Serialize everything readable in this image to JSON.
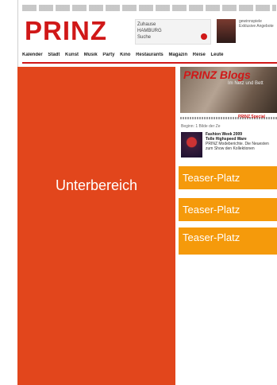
{
  "header": {
    "logo": "PRINZ",
    "city_box": {
      "line1": "Zuhause",
      "line2": "HAMBURG",
      "line3": "Suche"
    },
    "promo": {
      "line1": "gewinnspiele",
      "line2": "Exklusive Angebote"
    },
    "nav_items": [
      "Kalender",
      "Stadt",
      "Kunst",
      "Musik",
      "Party",
      "Kino",
      "Restaurants",
      "Magazin",
      "Reise",
      "Leute"
    ]
  },
  "main": {
    "unterbereich_label": "Unterbereich"
  },
  "sidebar": {
    "blogs_title": "PRINZ Blogs",
    "blogs_subtitle": "Im Netz und Bett",
    "special_label": "PRINZ Special",
    "meta_line": "Beginn: 1 Bilde der Ze",
    "article": {
      "headline": "Fashion Week 2009",
      "subline": "Tolle Highspeed Ware",
      "body": "PRINZ Modeberichte. Die Neuesten zum Show den Kollektionen"
    },
    "teasers": [
      "Teaser-Platz",
      "Teaser-Platz",
      "Teaser-Platz"
    ]
  },
  "colors": {
    "brand_red": "#d01818",
    "unterbereich_bg": "#e2461c",
    "teaser_bg": "#f59a0b"
  }
}
